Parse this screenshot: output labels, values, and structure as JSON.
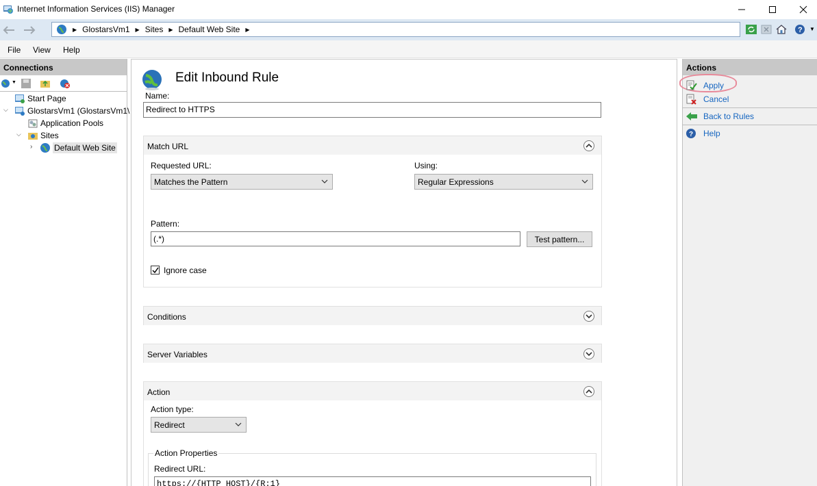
{
  "window": {
    "title": "Internet Information Services (IIS) Manager"
  },
  "address": {
    "crumbs": [
      "GlostarsVm1",
      "Sites",
      "Default Web Site"
    ]
  },
  "menu": {
    "items": [
      "File",
      "View",
      "Help"
    ]
  },
  "connections": {
    "header": "Connections",
    "tree": {
      "start_page": "Start Page",
      "server": "GlostarsVm1 (GlostarsVm1\\",
      "app_pools": "Application Pools",
      "sites": "Sites",
      "default_site": "Default Web Site"
    }
  },
  "main": {
    "title": "Edit Inbound Rule",
    "name_label": "Name:",
    "name_value": "Redirect to HTTPS",
    "match_url": {
      "header": "Match URL",
      "requested_url_label": "Requested URL:",
      "requested_url_value": "Matches the Pattern",
      "using_label": "Using:",
      "using_value": "Regular Expressions",
      "pattern_label": "Pattern:",
      "pattern_value": "(.*)",
      "test_pattern_button": "Test pattern...",
      "ignore_case_label": "Ignore case",
      "ignore_case_checked": true
    },
    "conditions": {
      "header": "Conditions"
    },
    "server_variables": {
      "header": "Server Variables"
    },
    "action": {
      "header": "Action",
      "type_label": "Action type:",
      "type_value": "Redirect",
      "properties_label": "Action Properties",
      "redirect_url_label": "Redirect URL:",
      "redirect_url_value": "https://{HTTP_HOST}/{R:1}"
    }
  },
  "actions": {
    "header": "Actions",
    "apply": "Apply",
    "cancel": "Cancel",
    "back_to_rules": "Back to Rules",
    "help": "Help"
  }
}
